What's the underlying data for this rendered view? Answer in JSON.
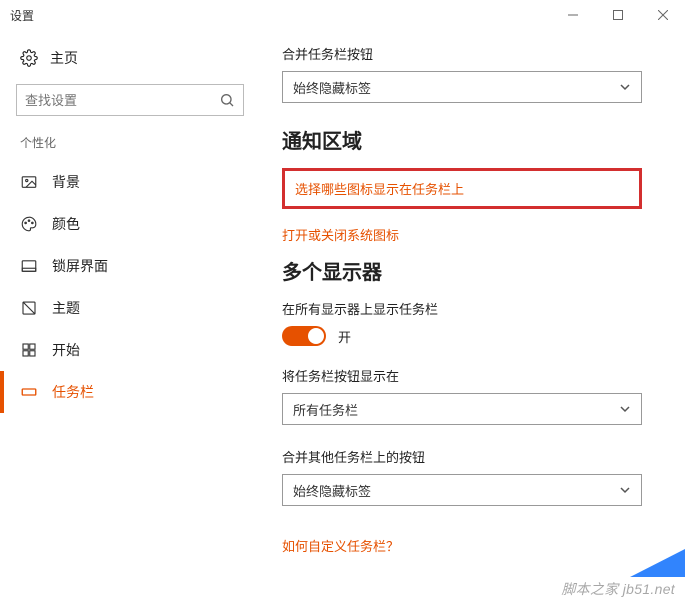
{
  "window": {
    "title": "设置"
  },
  "sidebar": {
    "home": "主页",
    "search_placeholder": "查找设置",
    "group": "个性化",
    "items": [
      {
        "label": "背景"
      },
      {
        "label": "颜色"
      },
      {
        "label": "锁屏界面"
      },
      {
        "label": "主题"
      },
      {
        "label": "开始"
      },
      {
        "label": "任务栏"
      }
    ]
  },
  "main": {
    "combine": {
      "label": "合并任务栏按钮",
      "value": "始终隐藏标签"
    },
    "notify_section": "通知区域",
    "link_choose_icons": "选择哪些图标显示在任务栏上",
    "link_system_icons": "打开或关闭系统图标",
    "multi_section": "多个显示器",
    "show_all": {
      "label": "在所有显示器上显示任务栏",
      "state": "开"
    },
    "show_buttons_on": {
      "label": "将任务栏按钮显示在",
      "value": "所有任务栏"
    },
    "combine_other": {
      "label": "合并其他任务栏上的按钮",
      "value": "始终隐藏标签"
    },
    "help_link": "如何自定义任务栏？"
  },
  "watermark": "脚本之家 jb51.net"
}
